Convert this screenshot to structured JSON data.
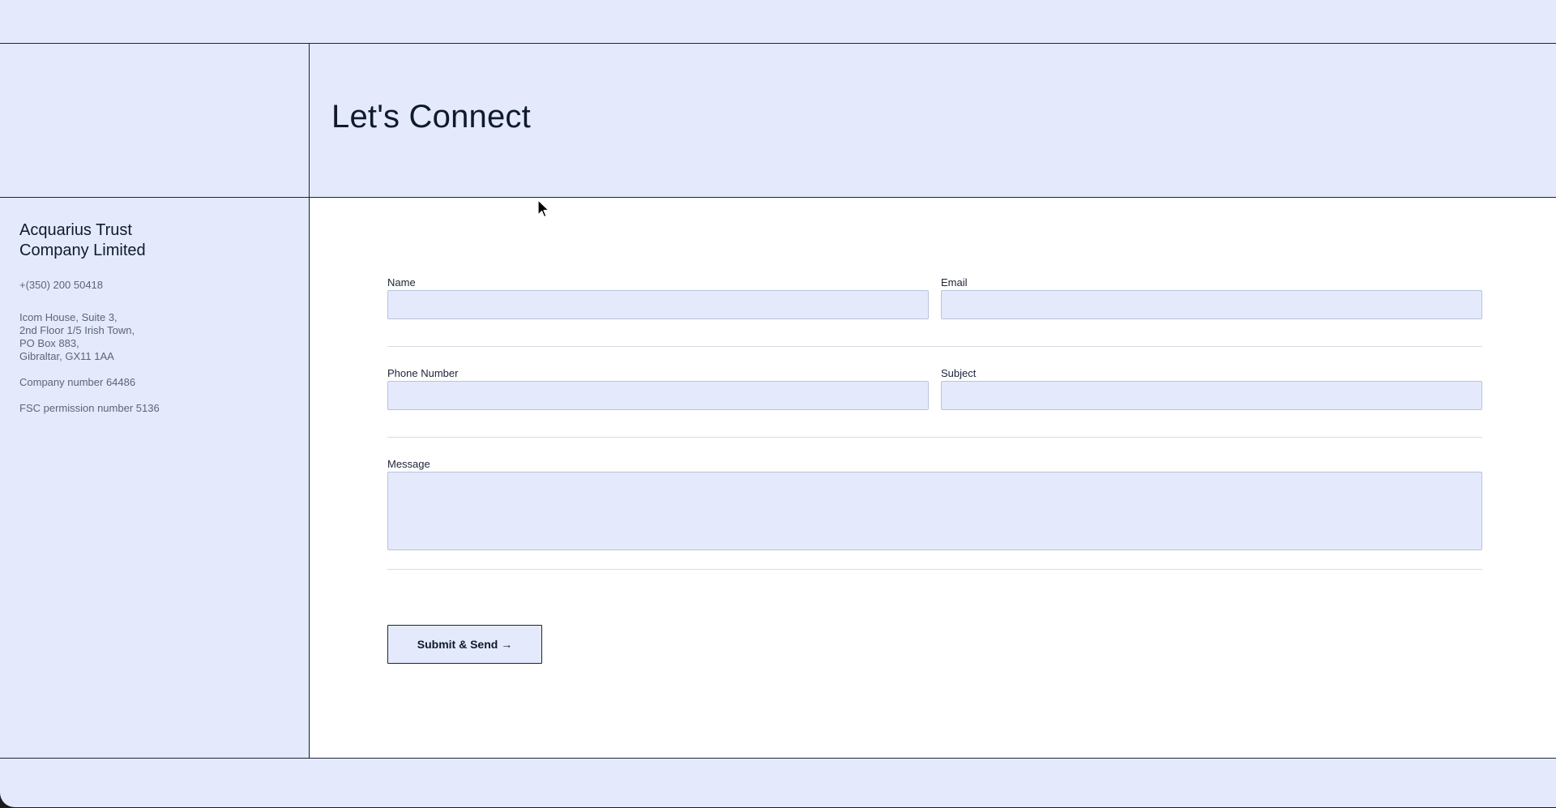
{
  "header": {
    "title": "Let's Connect"
  },
  "sidebar": {
    "company_name": "Acquarius Trust Company Limited",
    "phone": "+(350) 200 50418",
    "address_lines": [
      "Icom House, Suite 3,",
      "2nd Floor 1/5 Irish Town,",
      "PO Box 883,",
      "Gibraltar, GX11 1AA"
    ],
    "company_number": "Company number 64486",
    "fsc_number": "FSC permission number 5136"
  },
  "form": {
    "name_label": "Name",
    "name_value": "",
    "email_label": "Email",
    "email_value": "",
    "phone_label": "Phone Number",
    "phone_value": "",
    "subject_label": "Subject",
    "subject_value": "",
    "message_label": "Message",
    "message_value": "",
    "submit_label": "Submit & Send →"
  },
  "colors": {
    "background": "#e4eafc",
    "panel": "#ffffff",
    "text": "#0f1a2e",
    "muted_text": "#5b6577",
    "border": "#1d2433"
  }
}
